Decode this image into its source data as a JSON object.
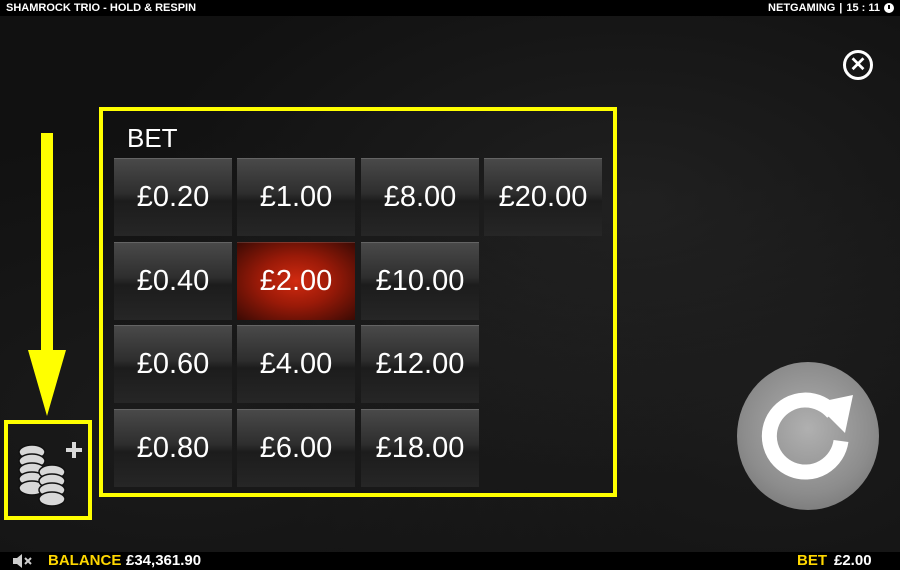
{
  "topbar": {
    "title": "SHAMROCK TRIO - HOLD & RESPIN",
    "brand": "NETGAMING",
    "separator": "|",
    "time": "15 : 11"
  },
  "bet_panel": {
    "title": "BET",
    "selected": "£2.00",
    "options": [
      "£0.20",
      "£1.00",
      "£8.00",
      "£20.00",
      "£0.40",
      "£2.00",
      "£10.00",
      "£0.60",
      "£4.00",
      "£12.00",
      "£0.80",
      "£6.00",
      "£18.00"
    ]
  },
  "close": {
    "symbol": "✕"
  },
  "footer": {
    "balance_label": "BALANCE",
    "balance_value": "£34,361.90",
    "bet_label": "BET",
    "bet_value": "£2.00"
  },
  "colors": {
    "highlight": "#ffff00",
    "selected_bet": "#c0200c",
    "label_gold": "#ffd700"
  },
  "icons": [
    "clock-icon",
    "close-icon",
    "coins-add-icon",
    "spin-icon",
    "mute-icon",
    "arrow-down-icon"
  ]
}
